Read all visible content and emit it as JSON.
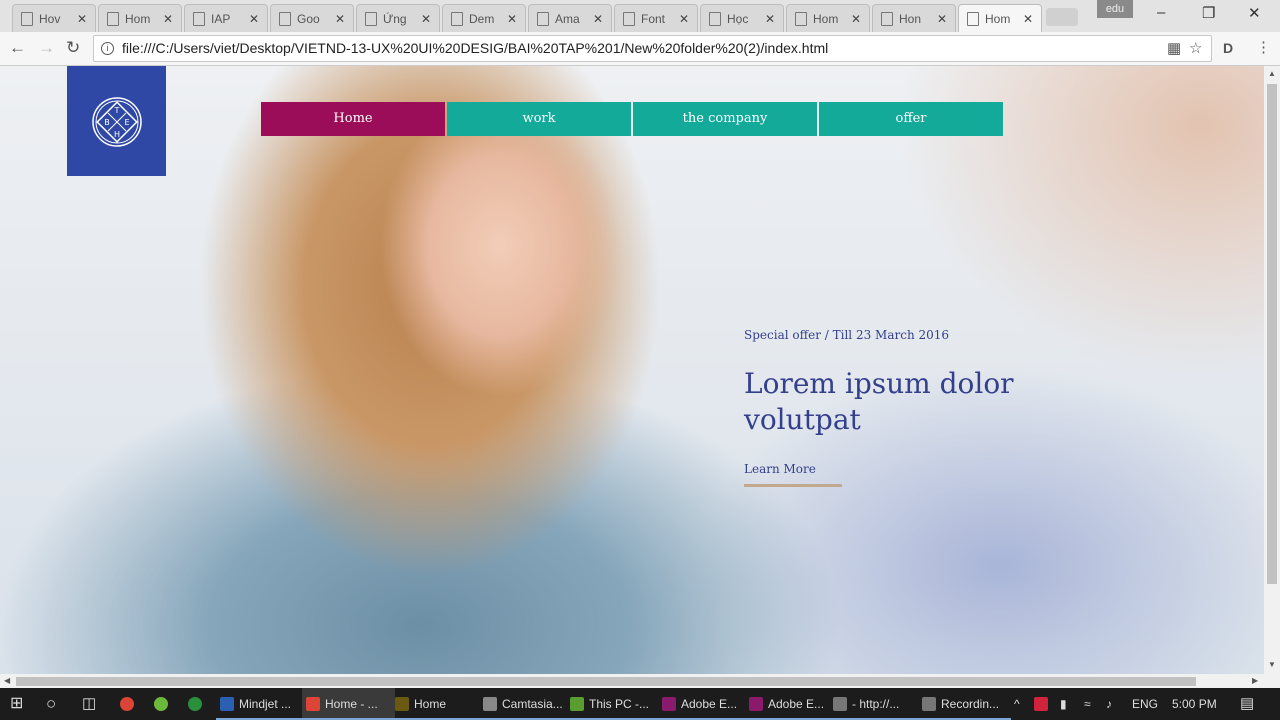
{
  "browser": {
    "tabs": [
      {
        "label": "Hov"
      },
      {
        "label": "Hom"
      },
      {
        "label": "IAP"
      },
      {
        "label": "Goo"
      },
      {
        "label": "Ứng"
      },
      {
        "label": "Dem"
      },
      {
        "label": "Ama"
      },
      {
        "label": "Font"
      },
      {
        "label": "Học"
      },
      {
        "label": "Hom"
      },
      {
        "label": "Hon"
      },
      {
        "label": "Hom",
        "active": true
      }
    ],
    "profile_label": "edu",
    "url": "file:///C:/Users/viet/Desktop/VIETND-13-UX%20UI%20DESIG/BAI%20TAP%201/New%20folder%20(2)/index.html"
  },
  "page": {
    "logo_letters": [
      "T",
      "B",
      "E",
      "H"
    ],
    "nav": [
      {
        "label": "Home",
        "active": true
      },
      {
        "label": "work"
      },
      {
        "label": "the company"
      },
      {
        "label": "offer"
      }
    ],
    "hero": {
      "kicker": "Special offer / Till 23 March 2016",
      "title": "Lorem ipsum dolor volutpat",
      "cta": "Learn More"
    },
    "colors": {
      "logo_bg": "#2f48a6",
      "nav_active": "#9b0d59",
      "nav": "#14aa9a",
      "text": "#34408c",
      "underline": "#c2a98e"
    }
  },
  "taskbar": {
    "apps": [
      {
        "label": "Mindjet ..."
      },
      {
        "label": "Home - ...",
        "active": true
      },
      {
        "label": "Home"
      },
      {
        "label": "Camtasia..."
      },
      {
        "label": "This PC -..."
      },
      {
        "label": "Adobe E..."
      },
      {
        "label": "Adobe E..."
      },
      {
        "label": "- http://..."
      },
      {
        "label": "Recordin..."
      }
    ],
    "language": "ENG",
    "time": "5:00 PM"
  }
}
